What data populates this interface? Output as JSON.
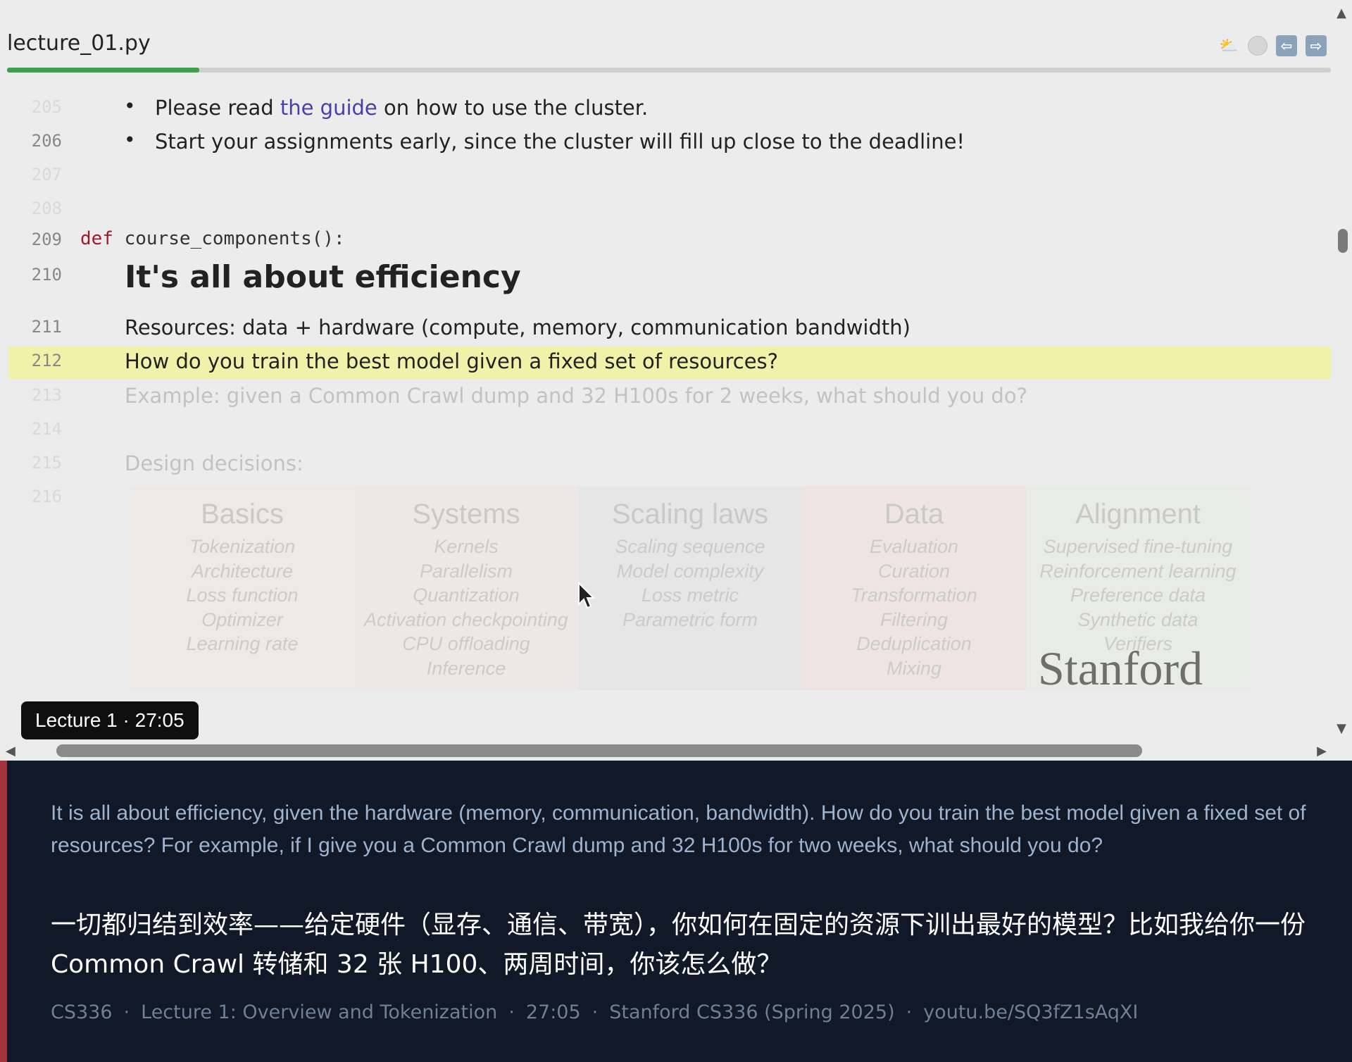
{
  "viewer": {
    "file_title": "lecture_01.py",
    "progress_percent": 14.5,
    "toolbar": {
      "weather_icon": "⛅",
      "back_icon": "⇦",
      "forward_icon": "⇨"
    }
  },
  "code": {
    "l205": {
      "num": "205",
      "before": "Please read ",
      "link": "the guide",
      "after": " on how to use the cluster."
    },
    "l206": {
      "num": "206",
      "text": "Start your assignments early, since the cluster will fill up close to the deadline!"
    },
    "l207": {
      "num": "207"
    },
    "l208": {
      "num": "208"
    },
    "l209": {
      "num": "209",
      "keyword": "def",
      "code": "course_components():"
    },
    "l210": {
      "num": "210",
      "text": "It's all about efficiency"
    },
    "l211": {
      "num": "211",
      "text": "Resources: data + hardware (compute, memory, communication bandwidth)"
    },
    "l212": {
      "num": "212",
      "text": "How do you train the best model given a fixed set of resources?"
    },
    "l213": {
      "num": "213",
      "text": "Example: given a Common Crawl dump and 32 H100s for 2 weeks, what should you do?"
    },
    "l214": {
      "num": "214"
    },
    "l215": {
      "num": "215",
      "text": "Design decisions:"
    },
    "l216": {
      "num": "216"
    }
  },
  "decisions": [
    {
      "title": "Basics",
      "items": [
        "Tokenization",
        "Architecture",
        "Loss function",
        "Optimizer",
        "Learning rate"
      ]
    },
    {
      "title": "Systems",
      "items": [
        "Kernels",
        "Parallelism",
        "Quantization",
        "Activation checkpointing",
        "CPU offloading",
        "Inference"
      ]
    },
    {
      "title": "Scaling laws",
      "items": [
        "Scaling sequence",
        "Model complexity",
        "Loss metric",
        "Parametric form"
      ]
    },
    {
      "title": "Data",
      "items": [
        "Evaluation",
        "Curation",
        "Transformation",
        "Filtering",
        "Deduplication",
        "Mixing"
      ]
    },
    {
      "title": "Alignment",
      "items": [
        "Supervised fine-tuning",
        "Reinforcement learning",
        "Preference data",
        "Synthetic data",
        "Verifiers"
      ]
    }
  ],
  "watermark": "Stanford",
  "badge": "Lecture 1 · 27:05",
  "caption": {
    "english": "It is all about efficiency, given the hardware (memory, communication, bandwidth). How do you train the best model given a fixed set of resources? For example, if I give you a Common Crawl dump and 32 H100s for two weeks, what should you do?",
    "chinese": "一切都归结到效率——给定硬件（显存、通信、带宽），你如何在固定的资源下训出最好的模型？比如我给你一份 Common Crawl 转储和 32 张 H100、两周时间，你该怎么做？",
    "meta": {
      "course": "CS336",
      "lecture": "Lecture 1: Overview and Tokenization",
      "time": "27:05",
      "series": "Stanford CS336 (Spring 2025)",
      "link": "youtu.be/SQ3fZ1sAqXI",
      "separator": "·"
    }
  },
  "colors": {
    "accent": "#a3333d",
    "progress": "#3aa24a",
    "highlight": "#eff2a8",
    "panel": "#111827"
  }
}
